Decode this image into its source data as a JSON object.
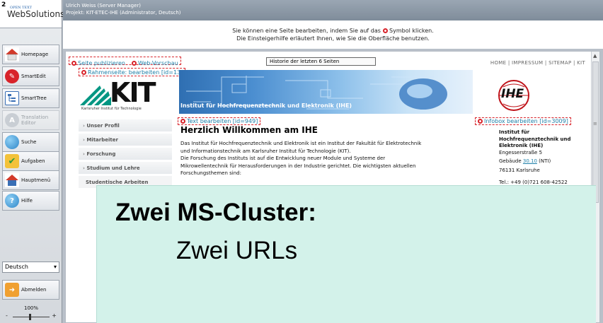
{
  "brand": {
    "number": "2",
    "opentext": "OPEN TEXT",
    "name": "WebSolutions"
  },
  "header": {
    "user": "Ulrich Weiss (Server Manager)",
    "project": "Projekt: KIT-ETEC-IHE (Administrator, Deutsch)"
  },
  "info_banner": {
    "line1_before": "Sie können eine Seite bearbeiten, indem Sie auf das",
    "line1_after": "Symbol klicken.",
    "line2": "Die Einsteigerhilfe erläutert Ihnen, wie Sie die Oberfläche benutzen."
  },
  "sidebar": {
    "items": [
      {
        "label": "Homepage",
        "icon": "home-icon",
        "color": "#d23a2a",
        "enabled": true
      },
      {
        "label": "SmartEdit",
        "icon": "smartedit-icon",
        "color": "#d8232a",
        "enabled": true
      },
      {
        "label": "SmartTree",
        "icon": "tree-icon",
        "color": "#3a6fb5",
        "enabled": true
      },
      {
        "label": "Translation Editor",
        "icon": "translation-icon",
        "color": "#b8bec5",
        "enabled": false
      },
      {
        "label": "Suche",
        "icon": "search-icon",
        "color": "#2e86c8",
        "enabled": true
      },
      {
        "label": "Aufgaben",
        "icon": "tasks-icon",
        "color": "#3aa655",
        "enabled": true
      },
      {
        "label": "Hauptmenü",
        "icon": "main-menu-icon",
        "color": "#d23a2a",
        "enabled": true
      },
      {
        "label": "Hilfe",
        "icon": "help-icon",
        "color": "#2e86c8",
        "enabled": true
      }
    ],
    "language": "Deutsch",
    "logout": "Abmelden",
    "zoom": "100%"
  },
  "page": {
    "publish_link": "Seite publizieren",
    "preview_link": "Web-Vorschau",
    "history_select": "Historie der letzten 6 Seiten",
    "top_links": "HOME | IMPRESSUM | SITEMAP | KIT",
    "frame_edit": "Rahmenseite: bearbeiten [id=13]",
    "kit_letters": "KIT",
    "kit_sub": "Karlsruher Institut für Technologie",
    "banner_title": "Institut für Hochfrequenztechnik und Elektronik (IHE)",
    "ihe_logo_text": "IHE",
    "subnav": [
      "Unser Profil",
      "Mitarbeiter",
      "Forschung",
      "Studium und Lehre",
      "Studentische Arbeiten"
    ],
    "text_edit": "Text bearbeiten [id=949]",
    "welcome": "Herzlich Willkommen am IHE",
    "body": [
      "Das Institut für Hochfrequenztechnik und Elektronik ist ein Institut der Fakultät für Elektrotechnik",
      "und Informationstechnik am Karlsruher Institut für Technologie (KIT).",
      "Die Forschung des Instituts ist auf die Entwicklung neuer Module und Systeme der",
      "Mikrowellentechnik für Herausforderungen in der Industrie gerichtet. Die wichtigsten aktuellen",
      "Forschungsthemen sind:"
    ],
    "infobox_edit": "Infobox bearbeiten [id=3009]",
    "infobox": {
      "name1": "Institut für",
      "name2": "Hochfrequenztechnik und",
      "name3": "Elektronik (IHE)",
      "street": "Engesserstraße 5",
      "building_prefix": "Gebäude ",
      "building_link": "30.10",
      "building_suffix": " (NTI)",
      "city": "76131 Karlsruhe",
      "phone": "Tel.: +49 (0)721 608-42522"
    }
  },
  "overlay": {
    "title": "Zwei MS-Cluster:",
    "subtitle": "Zwei URLs"
  }
}
